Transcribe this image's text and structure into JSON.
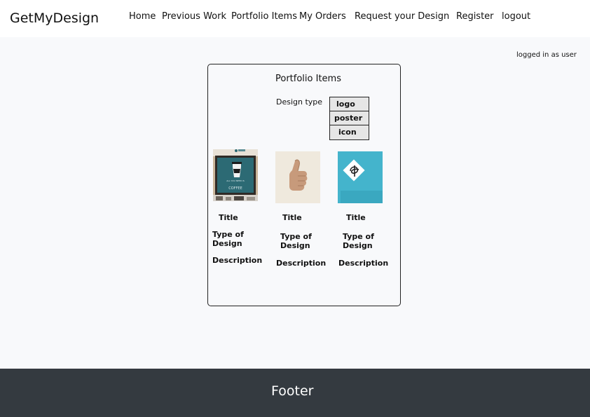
{
  "brand": "GetMyDesign",
  "nav": {
    "items": [
      {
        "label": "Home"
      },
      {
        "label": "Previous Work"
      },
      {
        "label": "Portfolio Items"
      },
      {
        "label": "My Orders"
      },
      {
        "label": "Request your Design"
      },
      {
        "label": "Register"
      },
      {
        "label": "logout"
      }
    ]
  },
  "status": {
    "logged_in": "logged in as user"
  },
  "portfolio": {
    "title": "Portfolio Items",
    "design_type_label": "Design type",
    "design_types": [
      "logo",
      "poster",
      "icon"
    ],
    "items": [
      {
        "image": "coffee-poster-image",
        "title": "Title",
        "type": "Type of Design",
        "description": "Description",
        "poster_text_1": "ALL YOU NEED IS",
        "poster_text_2": "COFFEE"
      },
      {
        "image": "thumbs-up-image",
        "title": "Title",
        "type": "Type of Design",
        "description": "Description"
      },
      {
        "image": "calligraphy-logo-image",
        "title": "Title",
        "type": "Type of Design",
        "description": "Description"
      }
    ]
  },
  "footer": {
    "text": "Footer"
  },
  "colors": {
    "navbar": "#ffffff",
    "page": "#f8f9fb",
    "footer": "#343a40",
    "teal": "#44b4cc"
  }
}
